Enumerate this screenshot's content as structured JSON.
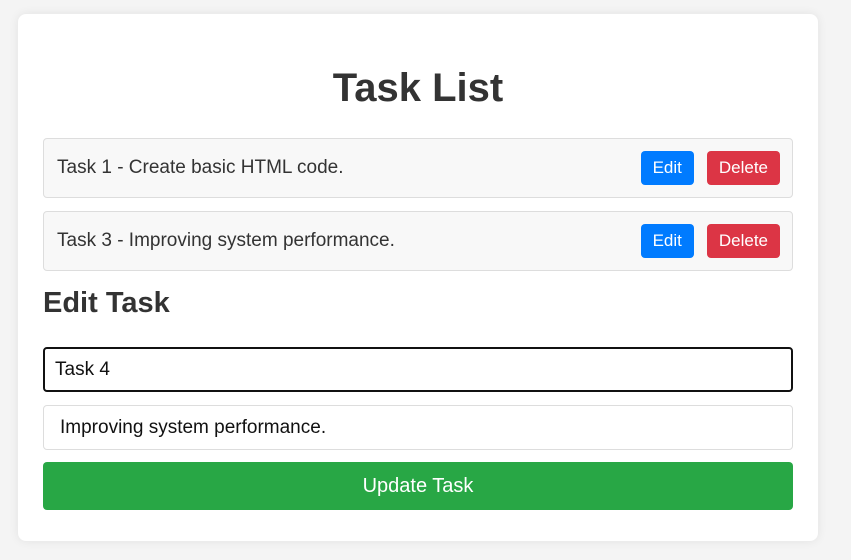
{
  "page": {
    "title": "Task List"
  },
  "tasks": [
    {
      "text": "Task 1 - Create basic HTML code.",
      "edit_label": "Edit",
      "delete_label": "Delete"
    },
    {
      "text": "Task 3 - Improving system performance.",
      "edit_label": "Edit",
      "delete_label": "Delete"
    }
  ],
  "edit_form": {
    "heading": "Edit Task",
    "title_value": "Task 4",
    "description_value": "Improving system performance.",
    "submit_label": "Update Task"
  },
  "colors": {
    "edit_button": "#007bff",
    "delete_button": "#dc3545",
    "update_button": "#28a745",
    "text": "#333333"
  }
}
